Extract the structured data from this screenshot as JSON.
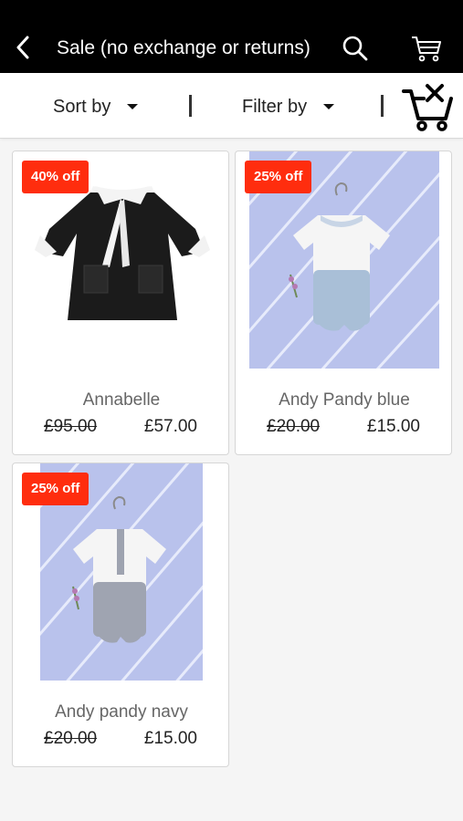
{
  "header": {
    "title": "Sale (no exchange or returns)",
    "back_icon": "chevron-left-icon",
    "search_icon": "search-icon",
    "cart_icon": "cart-icon"
  },
  "toolbar": {
    "sort_label": "Sort by",
    "filter_label": "Filter by",
    "clear_cart_icon": "cart-remove-icon"
  },
  "colors": {
    "header_bg": "#000000",
    "badge": "#ff2d0e",
    "photo_bg": "#b8c1ea"
  },
  "products": [
    {
      "badge": "40% off",
      "name": "Annabelle",
      "old_price": "£95.00",
      "price": "£57.00"
    },
    {
      "badge": "25% off",
      "name": "Andy Pandy blue",
      "old_price": "£20.00",
      "price": "£15.00"
    },
    {
      "badge": "25% off",
      "name": "Andy pandy navy",
      "old_price": "£20.00",
      "price": "£15.00"
    }
  ]
}
